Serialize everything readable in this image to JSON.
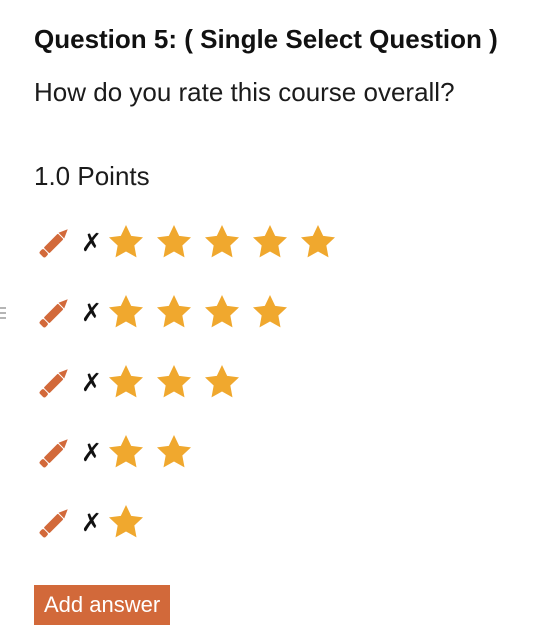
{
  "question": {
    "title": "Question 5: ( Single Select Question )",
    "text": "How do you rate this course overall?",
    "points": "1.0 Points"
  },
  "answers": [
    {
      "rating": 5,
      "delete_symbol": "✗"
    },
    {
      "rating": 4,
      "delete_symbol": "✗"
    },
    {
      "rating": 3,
      "delete_symbol": "✗"
    },
    {
      "rating": 2,
      "delete_symbol": "✗"
    },
    {
      "rating": 1,
      "delete_symbol": "✗"
    }
  ],
  "icons": {
    "edit": "pencil-icon",
    "delete": "cross-icon",
    "star": "star-icon"
  },
  "colors": {
    "accent": "#d2693a",
    "star": "#f0a82e",
    "button_text": "#ffffff"
  },
  "add_button_label": "Add answer"
}
